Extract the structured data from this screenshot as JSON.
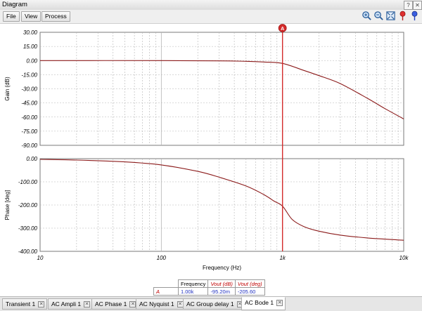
{
  "window": {
    "title": "Diagram",
    "help_label": "?",
    "close_label": "✕"
  },
  "toolbar": {
    "menu": [
      "File",
      "View",
      "Process"
    ],
    "tools": [
      "zoom-in-icon",
      "zoom-out-icon",
      "zoom-fit-icon",
      "cursor-marker-red-icon",
      "cursor-marker-blue-icon"
    ]
  },
  "colors": {
    "trace": "#8b1a1a",
    "cursor": "#d42a2a",
    "grid": "#b4b4b4"
  },
  "cursor": {
    "label": "A",
    "frequency": 1000
  },
  "chart_data": [
    {
      "type": "line",
      "xscale": "log",
      "xlim": [
        10,
        10000
      ],
      "ylim": [
        -90,
        30
      ],
      "ylabel": "Gain (dB)",
      "xlabel": "",
      "yticks": [
        "30.00",
        "15.00",
        "0.00",
        "-15.00",
        "-30.00",
        "-45.00",
        "-60.00",
        "-75.00",
        "-90.00"
      ],
      "grid": true,
      "series": [
        {
          "name": "Vout (dB)",
          "x": [
            10,
            100,
            300,
            500,
            700,
            1000,
            1500,
            2000,
            3000,
            5000,
            7000,
            10000
          ],
          "y": [
            0,
            0,
            -0.3,
            -0.8,
            -1.5,
            -3.0,
            -10.5,
            -16.0,
            -24.5,
            -40.0,
            -51.0,
            -62.0
          ]
        }
      ]
    },
    {
      "type": "line",
      "xscale": "log",
      "xlim": [
        10,
        10000
      ],
      "ylim": [
        -400,
        0
      ],
      "ylabel": "Phase [deg]",
      "xlabel": "Frequency (Hz)",
      "yticks": [
        "0.00",
        "-100.00",
        "-200.00",
        "-300.00",
        "-400.00"
      ],
      "xticks": [
        "10",
        "100",
        "1k",
        "10k"
      ],
      "grid": true,
      "series": [
        {
          "name": "Vout (deg)",
          "x": [
            10,
            20,
            50,
            100,
            200,
            300,
            500,
            700,
            850,
            1000,
            1200,
            1500,
            2000,
            3000,
            5000,
            10000
          ],
          "y": [
            -3,
            -6,
            -14,
            -27,
            -55,
            -80,
            -118,
            -155,
            -183,
            -205,
            -262,
            -293,
            -313,
            -330,
            -342,
            -352
          ]
        }
      ]
    }
  ],
  "cursor_table": {
    "headers": [
      "Frequency",
      "Vout (dB)",
      "Vout (deg)"
    ],
    "row": {
      "label": "A",
      "frequency": "1.00k",
      "db": "-95.20m",
      "deg": "-205.60"
    }
  },
  "tabs": [
    {
      "label": "Transient 1",
      "active": false
    },
    {
      "label": "AC Ampli 1",
      "active": false
    },
    {
      "label": "AC Phase 1",
      "active": false
    },
    {
      "label": "AC Nyquist 1",
      "active": false
    },
    {
      "label": "AC Group delay 1",
      "active": false
    },
    {
      "label": "AC Bode 1",
      "active": true
    }
  ],
  "tab_close_label": "✕"
}
